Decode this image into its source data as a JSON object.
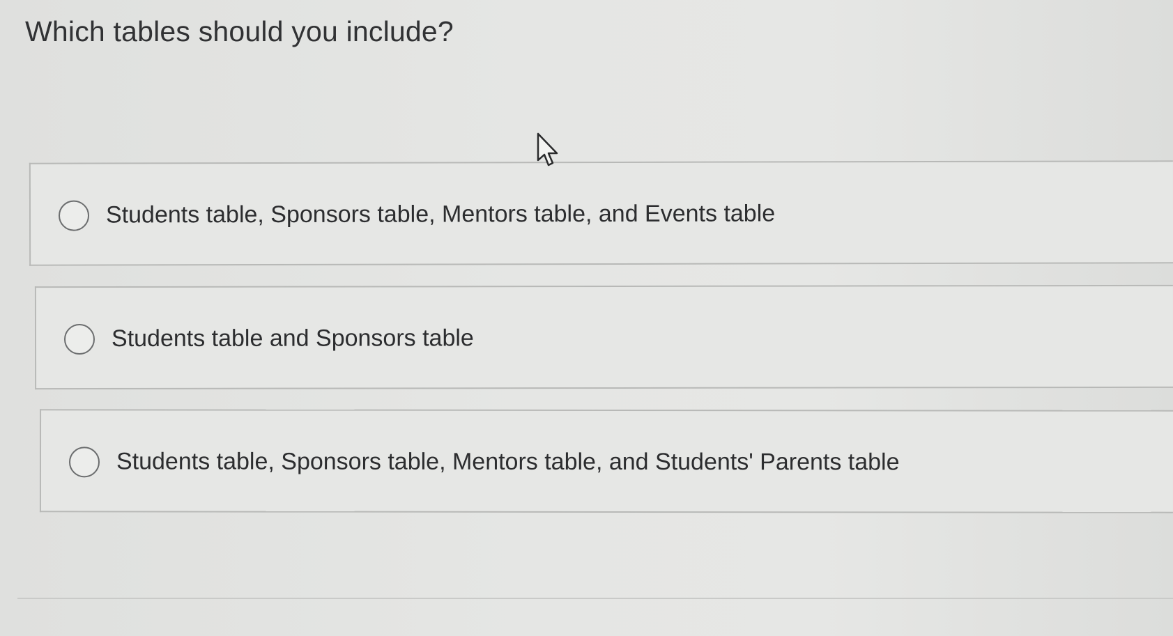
{
  "question": {
    "text": "Which tables should you include?"
  },
  "options": [
    {
      "label": "Students table, Sponsors table, Mentors table, and Events table",
      "selected": false
    },
    {
      "label": "Students table and Sponsors table",
      "selected": false
    },
    {
      "label": "Students table, Sponsors table, Mentors table, and Students' Parents table",
      "selected": false
    }
  ],
  "cursor": {
    "icon": "mouse-pointer-icon"
  },
  "colors": {
    "background": "#e2e3e1",
    "border": "#b8b9b7",
    "text": "#2f3031",
    "radio_border": "#6b6d6e"
  }
}
